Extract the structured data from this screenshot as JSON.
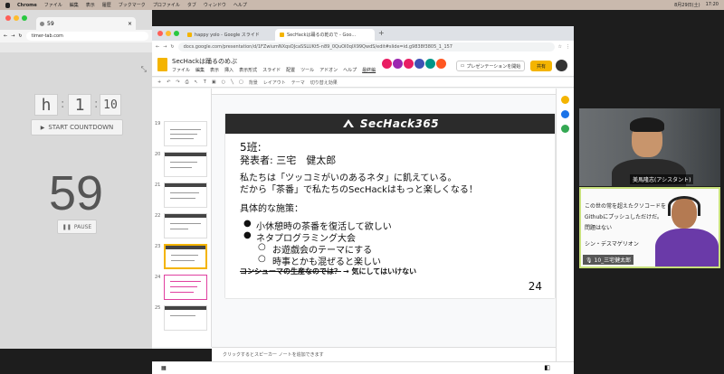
{
  "menubar": {
    "apple": "",
    "items": [
      "Chrome",
      "ファイル",
      "編集",
      "表示",
      "履歴",
      "ブックマーク",
      "プロファイル",
      "タブ",
      "ウィンドウ",
      "ヘルプ"
    ],
    "date": "8月29日(土)",
    "time": "17:20"
  },
  "timer_window": {
    "tab_title": "59",
    "url": "timer-tab.com",
    "hours": "h",
    "minutes": "1",
    "seconds": "10",
    "start_label": "START COUNTDOWN",
    "countdown": "59",
    "pause_label": "PAUSE"
  },
  "slides_window": {
    "tab1": "happy yolo - Google スライド",
    "tab2": "SecHackは踊るの乾ので - Goo...",
    "url": "docs.google.com/presentation/d/1FZwiumNXqsOJcaSSLUKt5-n89_0QuOI0qlX99QwdS/edit#slide=id.g9838f3805_1_157",
    "doc_title": "SecHackは踊るのめぶ",
    "menus": [
      "ファイル",
      "編集",
      "表示",
      "挿入",
      "表示形式",
      "スライド",
      "配置",
      "ツール",
      "アドオン",
      "ヘルプ",
      "最終編"
    ],
    "present_label": "プレゼンテーションを開始",
    "share_label": "共有",
    "toolbar_items": [
      "背景",
      "レイアウト",
      "テーマ",
      "切り替え効果"
    ],
    "notes_placeholder": "クリックするとスピーカー ノートを追加できます",
    "thumb_numbers": [
      "19",
      "20",
      "21",
      "22",
      "23",
      "24",
      "25",
      "26"
    ],
    "thumb_titles": [
      "自習用の休み中の",
      "",
      "",
      "",
      "",
      "",
      "",
      ""
    ]
  },
  "slide": {
    "logo": "SecHack365",
    "line1": "5班:",
    "line2": "発表者: 三宅　健太郎",
    "line3": "私たちは「ツッコミがいのあるネタ」に飢えている。",
    "line4": "だから「茶番」で私たちのSecHackはもっと楽しくなる！",
    "line5": "具体的な施策：",
    "bullet1": "小休憩時の茶番を復活して欲しい",
    "bullet2": "ネタプログラミング大会",
    "sub1": "お遊戯会のテーマにする",
    "sub2": "時事とかも混ぜると楽しい",
    "strike": "コンシューマの生産なのでは？",
    "arrow_text": "→ 気にしてはいけない",
    "page_number": "24"
  },
  "video": {
    "cam1_name": "美馬隆志(アシスタント)",
    "cam2_line1": "この世の常を超えたクソコードを",
    "cam2_line2": "Githubにプッシュしただけだ。",
    "cam2_line3": "問題はない",
    "cam2_line4": "シン・デスマゲリオン",
    "cam2_name": "10_三宅健太郎"
  },
  "colors": {
    "slides_yellow": "#f4b400",
    "speaker_border": "#c7e07a",
    "slide_header": "#2b2b2b"
  }
}
